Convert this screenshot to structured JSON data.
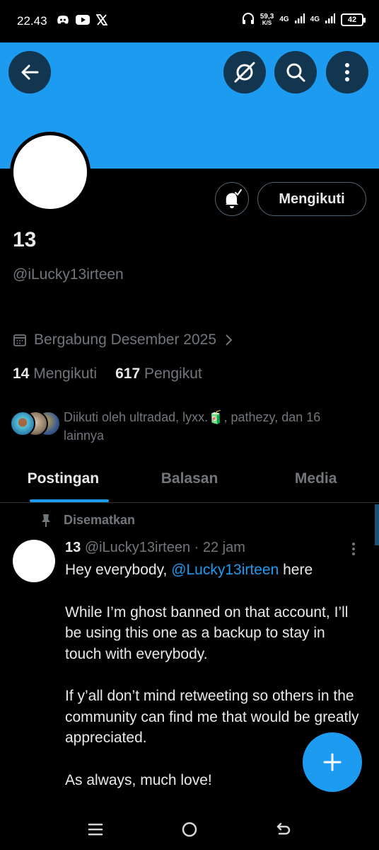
{
  "status_bar": {
    "time": "22.43",
    "left_icons": [
      "discord-icon",
      "youtube-icon",
      "x-icon"
    ],
    "speed_value": "59,3",
    "speed_unit": "K/S",
    "net1": "4G",
    "net2": "4G",
    "battery": "42"
  },
  "colors": {
    "accent": "#1d9bf0",
    "banner": "#1d9bf0",
    "muted": "#71767b",
    "text": "#e7e9ea"
  },
  "header": {
    "back_icon": "arrow-left-icon",
    "actions": [
      "grok-icon",
      "search-icon",
      "more-vertical-icon"
    ]
  },
  "profile": {
    "name": "13",
    "handle": "@iLucky13irteen",
    "follow_button": "Mengikuti",
    "joined": "Bergabung Desember 2025",
    "following_count": "14",
    "following_label": "Mengikuti",
    "followers_count": "617",
    "followers_label": "Pengikut",
    "followed_by": "Diikuti oleh ultradad, lyxx.🧃, pathezy, dan 16 lainnya"
  },
  "tabs": [
    {
      "label": "Postingan",
      "active": true
    },
    {
      "label": "Balasan",
      "active": false
    },
    {
      "label": "Media",
      "active": false
    }
  ],
  "post": {
    "pinned_label": "Disematkan",
    "author_name": "13",
    "author_handle": "@iLucky13irteen",
    "time": "· 22 jam",
    "line1_prefix": "Hey everybody, ",
    "line1_mention": "@Lucky13irteen",
    "line1_suffix": " here",
    "para2": "While I’m ghost banned on that account, I’ll be using this one as a backup to stay in touch with everybody.",
    "para3": "If y’all don’t mind retweeting so others in the community can find me that would be greatly appreciated.",
    "para4": "As always, much love!"
  }
}
